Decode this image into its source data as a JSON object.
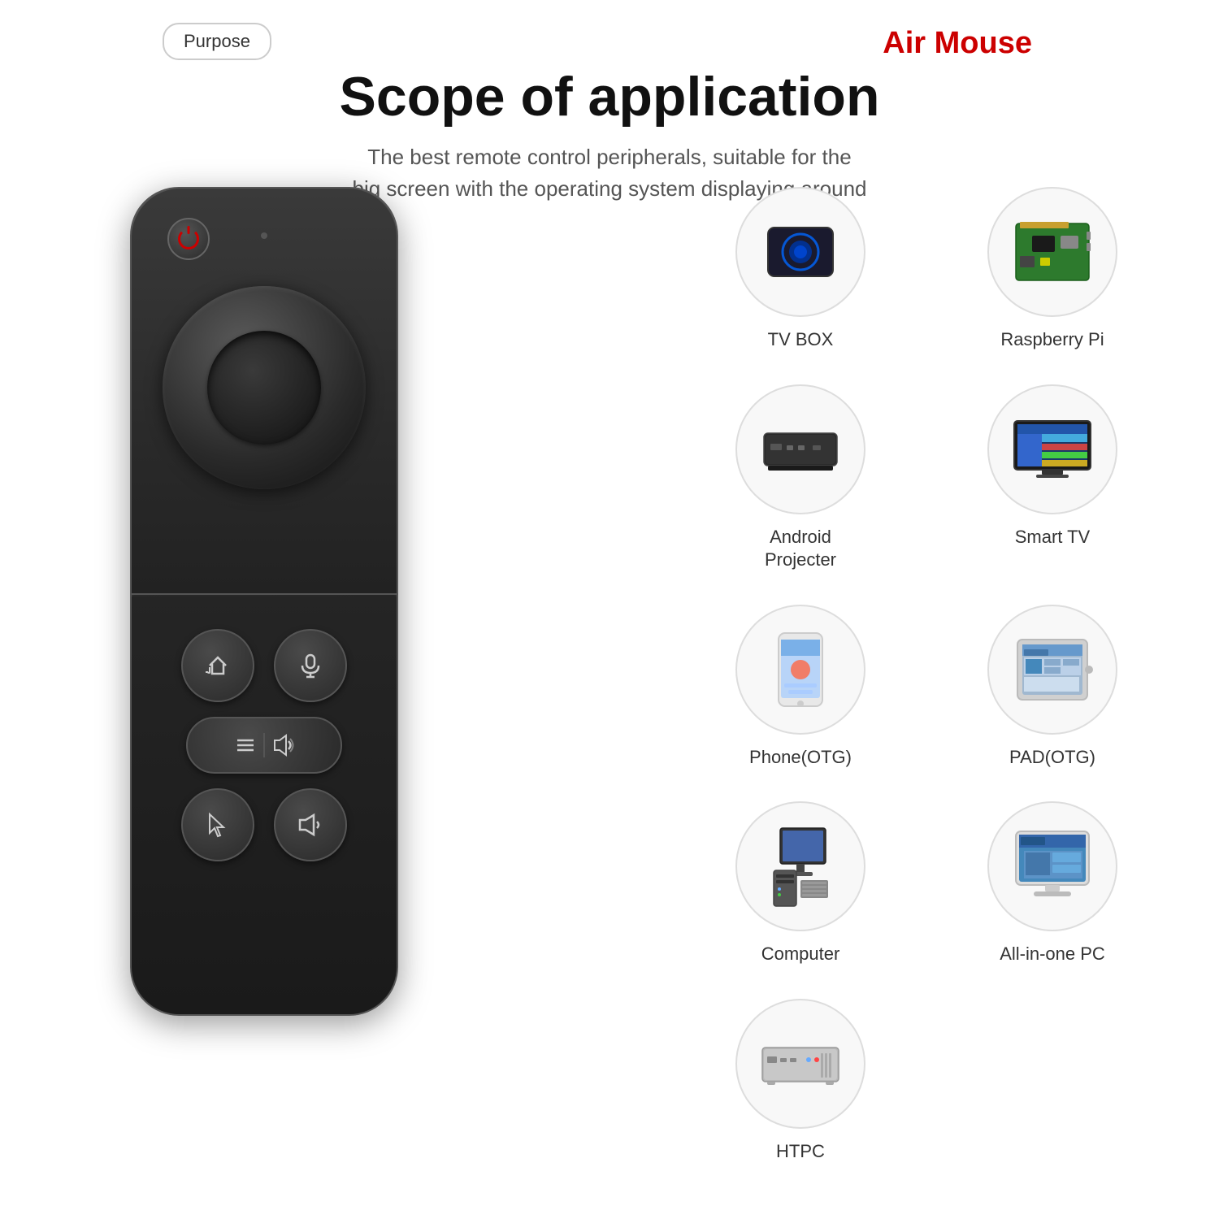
{
  "badge": {
    "purpose": "Purpose",
    "air_mouse": "Air Mouse"
  },
  "header": {
    "title": "Scope of application",
    "subtitle_line1": "The best remote control peripherals, suitable for the",
    "subtitle_line2": "big screen with the operating system displaying around"
  },
  "devices": [
    {
      "id": "tv-box",
      "label": "TV BOX",
      "type": "tvbox"
    },
    {
      "id": "raspberry-pi",
      "label": "Raspberry Pi",
      "type": "raspi"
    },
    {
      "id": "android-projector",
      "label": "Android\nProjecter",
      "type": "projector"
    },
    {
      "id": "smart-tv",
      "label": "Smart TV",
      "type": "smarttv"
    },
    {
      "id": "phone-otg",
      "label": "Phone(OTG)",
      "type": "phone"
    },
    {
      "id": "pad-otg",
      "label": "PAD(OTG)",
      "type": "pad"
    },
    {
      "id": "computer",
      "label": "Computer",
      "type": "computer"
    },
    {
      "id": "all-in-one",
      "label": "All-in-one PC",
      "type": "aio"
    },
    {
      "id": "htpc",
      "label": "HTPC",
      "type": "htpc"
    }
  ],
  "remote": {
    "buttons": [
      "home-back",
      "microphone",
      "menu",
      "volume-up",
      "mouse",
      "volume-down"
    ]
  }
}
